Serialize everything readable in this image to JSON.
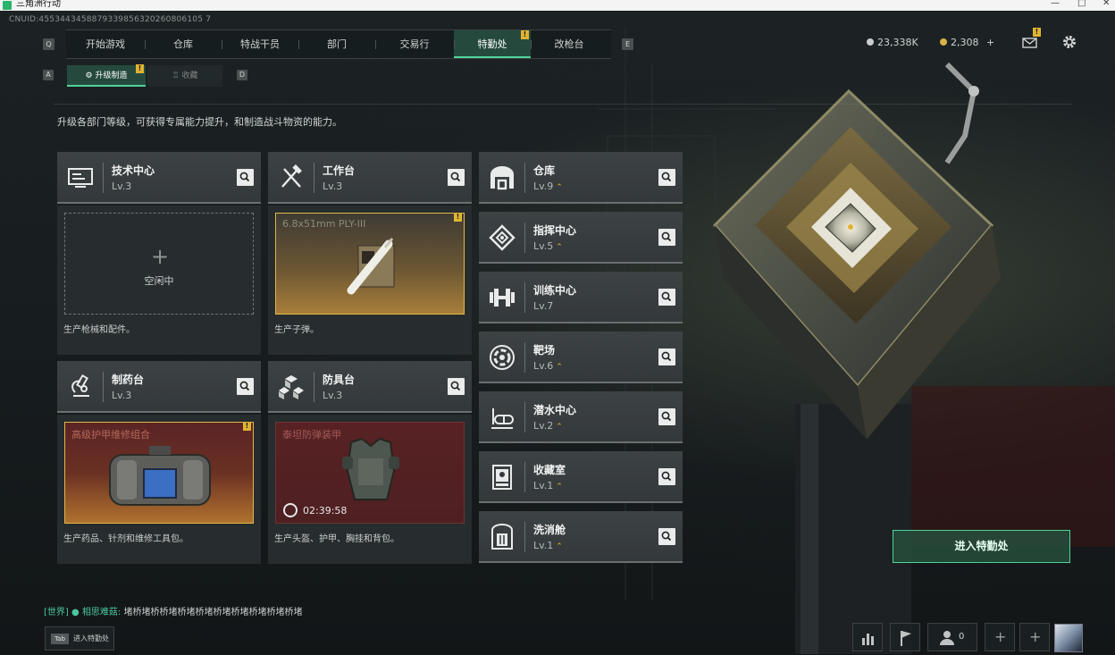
{
  "window": {
    "title": "三角洲行动"
  },
  "uid": "CNUID:4553443458879339856320260806105 7",
  "nav": {
    "left_key": "Q",
    "right_key": "E",
    "tabs": [
      {
        "label": "开始游戏"
      },
      {
        "label": "仓库"
      },
      {
        "label": "特战干员"
      },
      {
        "label": "部门"
      },
      {
        "label": "交易行"
      },
      {
        "label": "特勤处",
        "active": true,
        "badge": "!"
      },
      {
        "label": "改枪台"
      }
    ]
  },
  "currency": {
    "silver": "23,338K",
    "gold": "2,308",
    "add": "+"
  },
  "mail_badge": "!",
  "subnav": {
    "left_key": "A",
    "right_key": "D",
    "tabs": [
      {
        "label": "升级制造",
        "active": true,
        "badge": "!"
      },
      {
        "label": "收藏"
      }
    ]
  },
  "description": "升级各部门等级，可获得专属能力提升，和制造战斗物资的能力。",
  "production": [
    {
      "name": "技术中心",
      "level": "Lv.3",
      "icon": "monitor-icon",
      "slot": {
        "type": "empty",
        "plus": "+",
        "label": "空闲中"
      },
      "desc": "生产枪械和配件。"
    },
    {
      "name": "工作台",
      "level": "Lv.3",
      "icon": "tools-icon",
      "slot": {
        "type": "ammo",
        "item": "6.8x51mm PLY-III",
        "badge": "!"
      },
      "desc": "生产子弹。"
    },
    {
      "name": "制药台",
      "level": "Lv.3",
      "icon": "microscope-icon",
      "slot": {
        "type": "med",
        "item": "高级护甲维修组合",
        "badge": "!"
      },
      "desc": "生产药品、针剂和维修工具包。"
    },
    {
      "name": "防具台",
      "level": "Lv.3",
      "icon": "cubes-icon",
      "slot": {
        "type": "armor",
        "item": "泰坦防弹装甲",
        "timer": "02:39:58"
      },
      "desc": "生产头盔、护甲、胸挂和背包。"
    }
  ],
  "facilities": [
    {
      "name": "仓库",
      "level": "Lv.9",
      "upgradable": true,
      "icon": "warehouse-icon"
    },
    {
      "name": "指挥中心",
      "level": "Lv.5",
      "upgradable": true,
      "icon": "command-diamond-icon"
    },
    {
      "name": "训练中心",
      "level": "Lv.7",
      "upgradable": false,
      "icon": "dumbbell-icon"
    },
    {
      "name": "靶场",
      "level": "Lv.6",
      "upgradable": true,
      "icon": "target-icon"
    },
    {
      "name": "潜水中心",
      "level": "Lv.2",
      "upgradable": true,
      "icon": "diving-mask-icon"
    },
    {
      "name": "收藏室",
      "level": "Lv.1",
      "upgradable": true,
      "icon": "display-case-icon"
    },
    {
      "name": "洗消舱",
      "level": "Lv.1",
      "upgradable": true,
      "icon": "decon-chamber-icon"
    }
  ],
  "upgrade_glyph": "⌃",
  "enter_button": "进入特勤处",
  "chat": {
    "channel": "[世界]",
    "sender": "相思难菇",
    "message": "堵桥堵桥桥堵桥堵桥堵桥堵桥堵桥堵桥堵桥堵"
  },
  "tab_hint": {
    "key": "Tab",
    "label": "进入特勤处"
  },
  "bottom_bar": {
    "friends_count": "0"
  },
  "colors": {
    "accent": "#4fd39a",
    "badge": "#e0b431",
    "active_tab": "#254a3d"
  }
}
